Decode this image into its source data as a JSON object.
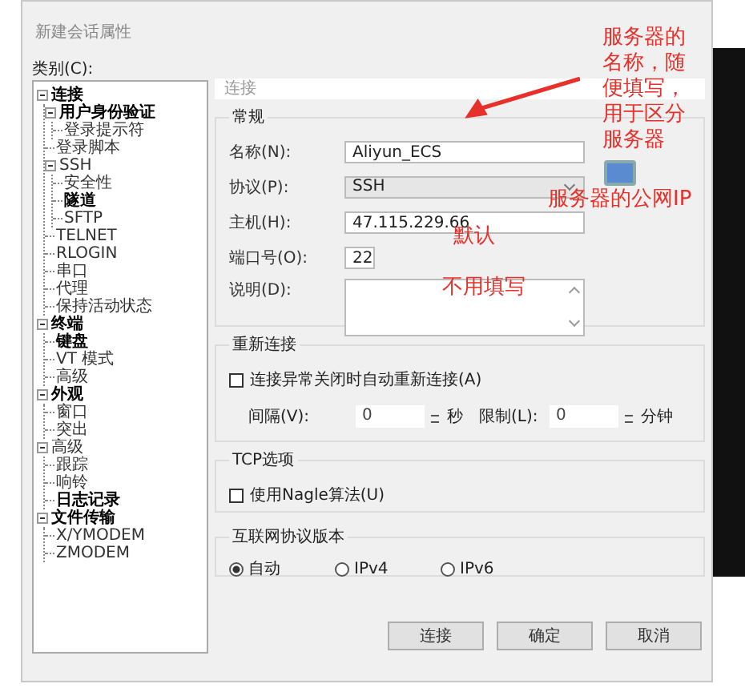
{
  "window": {
    "title": "新建会话属性"
  },
  "category_label": "类别(C):",
  "tree": [
    {
      "label": "连接",
      "bold": true,
      "expanded": true,
      "children": [
        {
          "label": "用户身份验证",
          "bold": true,
          "expanded": true,
          "children": [
            {
              "label": "登录提示符",
              "bold": false
            }
          ]
        },
        {
          "label": "登录脚本",
          "bold": false
        },
        {
          "label": "SSH",
          "bold": false,
          "expanded": true,
          "children": [
            {
              "label": "安全性",
              "bold": false
            },
            {
              "label": "隧道",
              "bold": true
            },
            {
              "label": "SFTP",
              "bold": false
            }
          ]
        },
        {
          "label": "TELNET",
          "bold": false
        },
        {
          "label": "RLOGIN",
          "bold": false
        },
        {
          "label": "串口",
          "bold": false
        },
        {
          "label": "代理",
          "bold": false
        },
        {
          "label": "保持活动状态",
          "bold": false
        }
      ]
    },
    {
      "label": "终端",
      "bold": true,
      "expanded": true,
      "children": [
        {
          "label": "键盘",
          "bold": true
        },
        {
          "label": "VT 模式",
          "bold": false
        },
        {
          "label": "高级",
          "bold": false
        }
      ]
    },
    {
      "label": "外观",
      "bold": true,
      "expanded": true,
      "children": [
        {
          "label": "窗口",
          "bold": false
        },
        {
          "label": "突出",
          "bold": false
        }
      ]
    },
    {
      "label": "高级",
      "bold": false,
      "expanded": true,
      "children": [
        {
          "label": "跟踪",
          "bold": false
        },
        {
          "label": "响铃",
          "bold": false
        },
        {
          "label": "日志记录",
          "bold": true
        }
      ]
    },
    {
      "label": "文件传输",
      "bold": true,
      "expanded": true,
      "children": [
        {
          "label": "X/YMODEM",
          "bold": false
        },
        {
          "label": "ZMODEM",
          "bold": false
        }
      ]
    }
  ],
  "panel_header": "连接",
  "general": {
    "title": "常规",
    "fields": [
      {
        "kind": "text",
        "label": "名称(N):",
        "value": "Aliyun_ECS"
      },
      {
        "kind": "select",
        "label": "协议(P):",
        "value": "SSH"
      },
      {
        "kind": "text",
        "label": "主机(H):",
        "value": "47.115.229.66"
      },
      {
        "kind": "spin",
        "label": "端口号(O):",
        "value": "22"
      },
      {
        "kind": "textarea",
        "label": "说明(D):"
      }
    ]
  },
  "reconnect": {
    "title": "重新连接",
    "checkbox": {
      "label": "连接异常关闭时自动重新连接(A)",
      "checked": false
    },
    "interval": {
      "label": "间隔(V):",
      "value": "0",
      "unit": "秒"
    },
    "limit": {
      "label": "限制(L):",
      "value": "0",
      "unit": "分钟"
    }
  },
  "tcp": {
    "title": "TCP选项",
    "checkbox": {
      "label": "使用Nagle算法(U)",
      "checked": false
    }
  },
  "ip_version": {
    "title": "互联网协议版本",
    "options": [
      {
        "label": "自动",
        "selected": true
      },
      {
        "label": "IPv4",
        "selected": false
      },
      {
        "label": "IPv6",
        "selected": false
      }
    ]
  },
  "buttons": [
    "连接",
    "确定",
    "取消"
  ],
  "annotations": [
    {
      "text": "服务器的名称，随便填写，用于区分服务器",
      "kind": "arrow"
    },
    {
      "text": "服务器的公网IP",
      "kind": "note"
    },
    {
      "text": "默认",
      "kind": "note"
    },
    {
      "text": "不用填写",
      "kind": "note"
    }
  ]
}
